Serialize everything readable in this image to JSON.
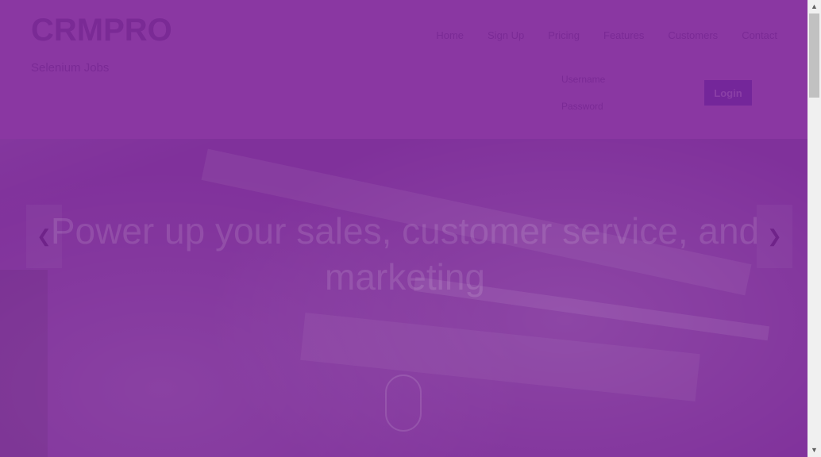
{
  "brand": {
    "logo": "CRMPRO",
    "subtitle": "Selenium Jobs"
  },
  "nav": [
    "Home",
    "Sign Up",
    "Pricing",
    "Features",
    "Customers",
    "Contact"
  ],
  "login": {
    "username_placeholder": "Username",
    "password_placeholder": "Password",
    "button": "Login"
  },
  "hero": {
    "headline": "Power up your sales, customer service, and marketing"
  },
  "icons": {
    "prev": "chevron-left-icon",
    "next": "chevron-right-icon",
    "scroll": "mouse-scroll-icon"
  },
  "colors": {
    "overlay": "#80319b",
    "header": "#8a37a2",
    "button": "#74269a"
  }
}
